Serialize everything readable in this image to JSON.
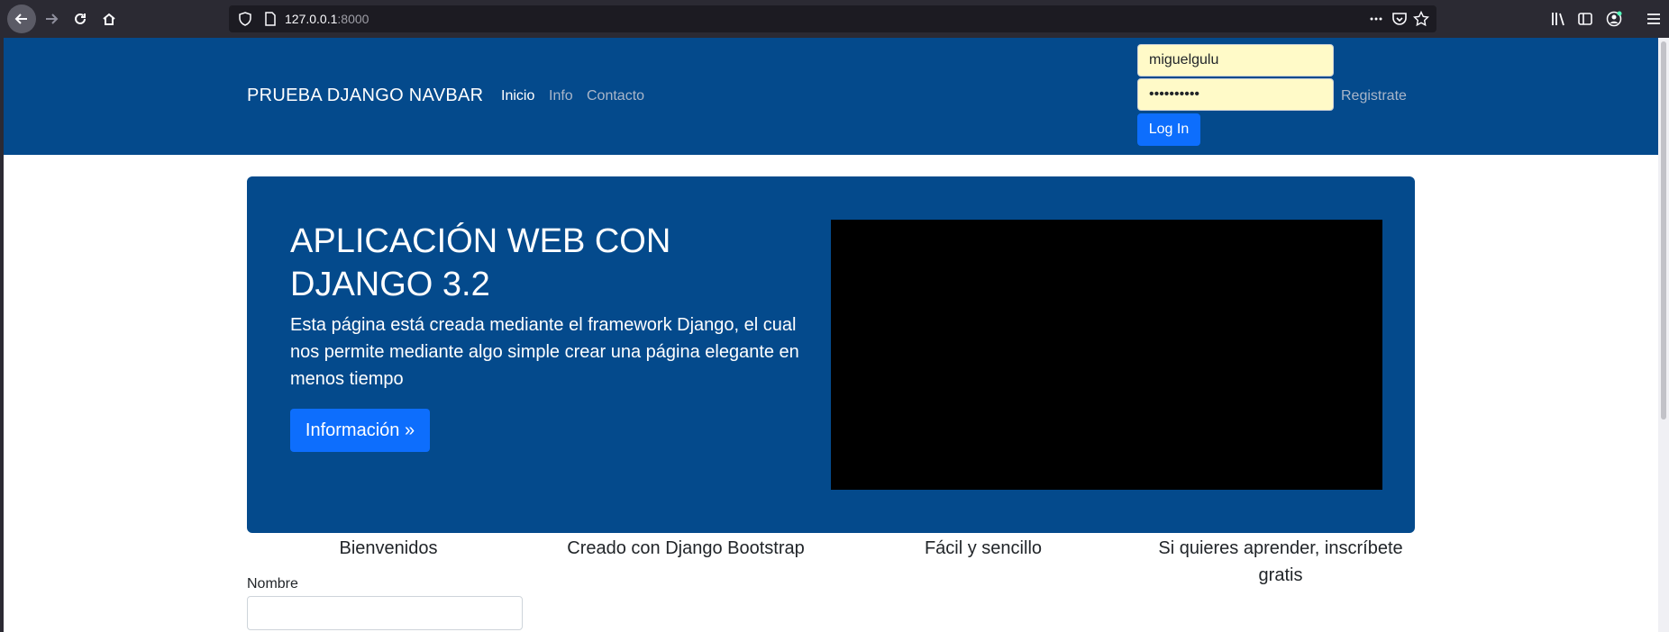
{
  "browser": {
    "url_host": "127.0.0.1",
    "url_port": ":8000"
  },
  "navbar": {
    "brand": "PRUEBA DJANGO NAVBAR",
    "links": [
      "Inicio",
      "Info",
      "Contacto"
    ],
    "username_value": "miguelgulu",
    "password_value": "••••••••••",
    "login_label": "Log In",
    "register_label": "Registrate"
  },
  "jumbotron": {
    "title": "APLICACIÓN WEB CON DJANGO 3.2",
    "text": "Esta página está creada mediante el framework Django, el cual nos permite mediante algo simple crear una página elegante en menos tiempo",
    "button_label": "Información »"
  },
  "features": [
    "Bienvenidos",
    "Creado con Django Bootstrap",
    "Fácil y sencillo",
    "Si quieres aprender, inscríbete gratis"
  ],
  "form": {
    "name_label": "Nombre",
    "name_value": ""
  },
  "colors": {
    "navbar_bg": "#044a8c",
    "primary_button": "#0d6efd",
    "autofill_bg": "#fffac8",
    "browser_chrome": "#2b2a33"
  }
}
